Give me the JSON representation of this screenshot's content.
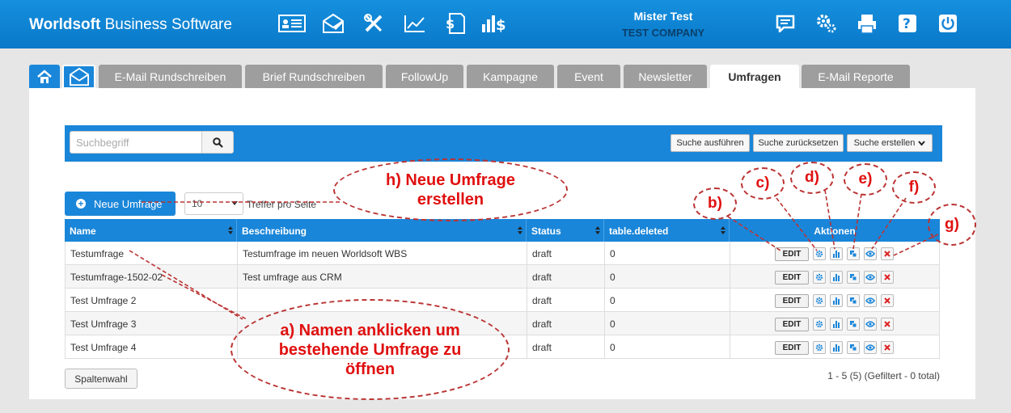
{
  "header": {
    "brand_bold": "Worldsoft",
    "brand_rest": " Business Software",
    "user_name": "Mister Test",
    "company": "TEST COMPANY"
  },
  "tabs": [
    {
      "label": "E-Mail Rundschreiben"
    },
    {
      "label": "Brief Rundschreiben"
    },
    {
      "label": "FollowUp"
    },
    {
      "label": "Kampagne"
    },
    {
      "label": "Event"
    },
    {
      "label": "Newsletter"
    },
    {
      "label": "Umfragen"
    },
    {
      "label": "E-Mail Reporte"
    }
  ],
  "search": {
    "placeholder": "Suchbegriff",
    "run": "Suche ausführen",
    "reset": "Suche zurücksetzen",
    "create": "Suche erstellen"
  },
  "toolbar": {
    "new_survey": "Neue Umfrage",
    "per_page_value": "10",
    "per_page_label": "Treffer pro Seite"
  },
  "table": {
    "columns": [
      "Name",
      "Beschreibung",
      "Status",
      "table.deleted",
      "Aktionen"
    ],
    "edit_label": "EDIT",
    "rows": [
      {
        "name": "Testumfrage",
        "desc": "Testumfrage im neuen Worldsoft WBS",
        "status": "draft",
        "deleted": "0"
      },
      {
        "name": "Testumfrage-1502-02",
        "desc": "Test umfrage aus CRM",
        "status": "draft",
        "deleted": "0"
      },
      {
        "name": "Test Umfrage 2",
        "desc": "",
        "status": "draft",
        "deleted": "0"
      },
      {
        "name": "Test Umfrage 3",
        "desc": "",
        "status": "draft",
        "deleted": "0"
      },
      {
        "name": "Test Umfrage 4",
        "desc": "",
        "status": "draft",
        "deleted": "0"
      }
    ]
  },
  "footer": {
    "columns_button": "Spaltenwahl",
    "paging_info": "1 - 5 (5) (Gefiltert - 0 total)"
  },
  "annotations": {
    "a": "a) Namen anklicken um bestehende Umfrage zu öffnen",
    "b": "b)",
    "c": "c)",
    "d": "d)",
    "e": "e)",
    "f": "f)",
    "g": "g)",
    "h": "h) Neue Umfrage erstellen"
  },
  "colors": {
    "primary": "#1a86d9",
    "annotation": "#e01010"
  }
}
